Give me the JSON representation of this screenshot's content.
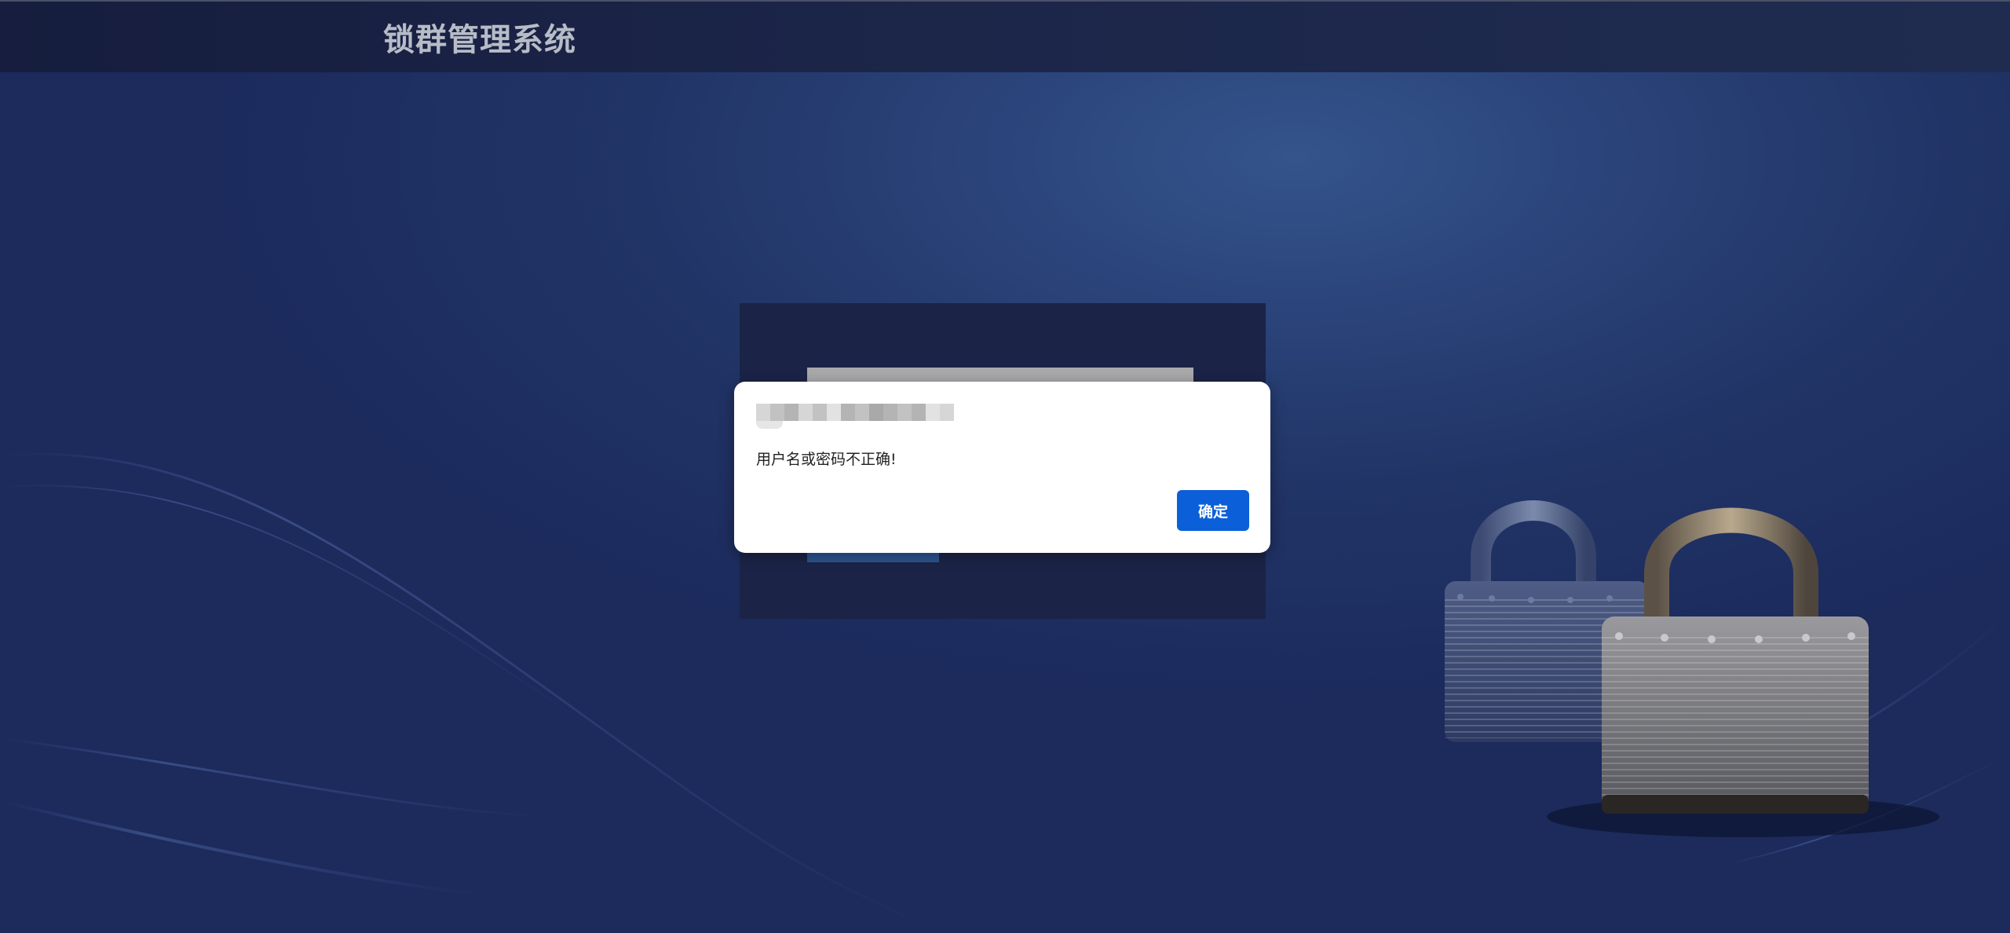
{
  "header": {
    "title": "锁群管理系统"
  },
  "dialog": {
    "origin_text": "",
    "message": "用户名或密码不正确!",
    "ok_label": "确定"
  },
  "colors": {
    "accent": "#0b5fd8",
    "background": "#213466",
    "topbar": "#1b2548"
  },
  "decor": {
    "image": "padlocks-illustration"
  }
}
